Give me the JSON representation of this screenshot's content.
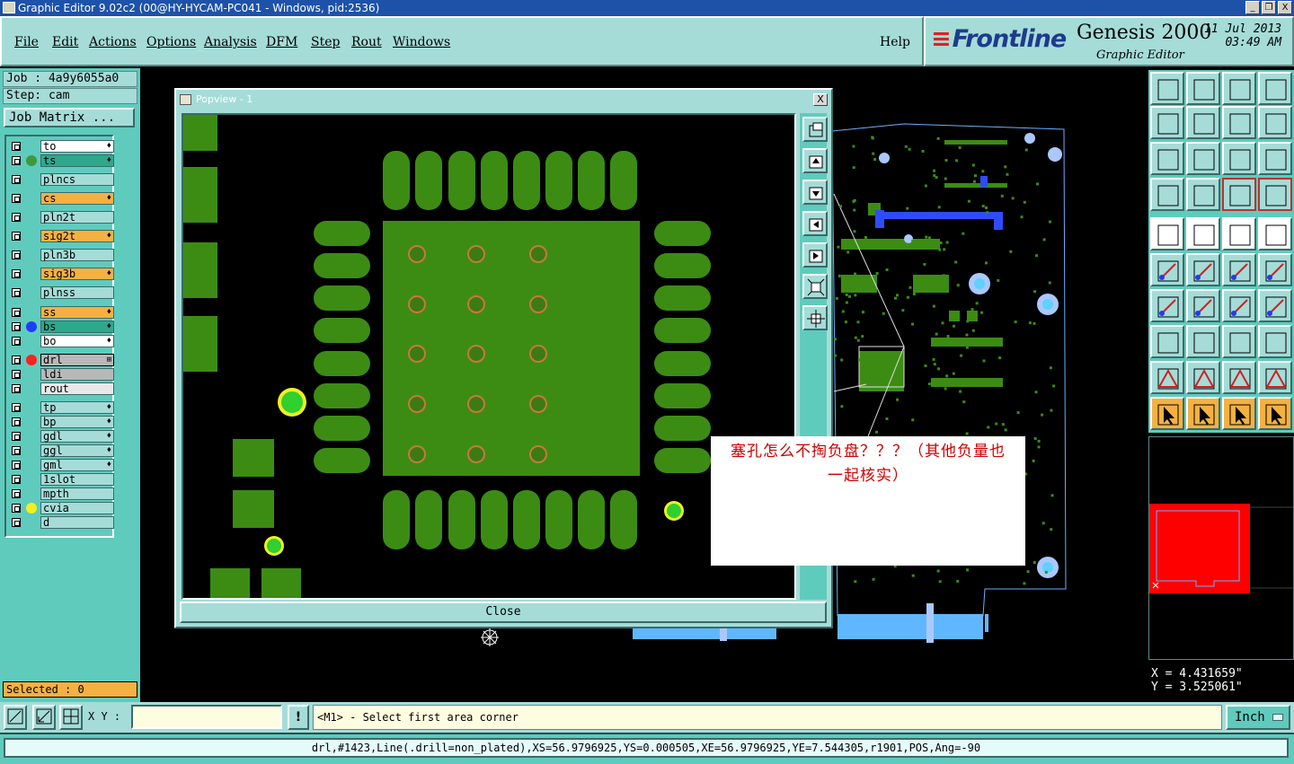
{
  "window": {
    "title": "Graphic Editor 9.02c2 (00@HY-HYCAM-PC041 - Windows, pid:2536)",
    "min": "_",
    "restore": "❐",
    "close": "X"
  },
  "menu": {
    "items": [
      "File",
      "Edit",
      "Actions",
      "Options",
      "Analysis",
      "DFM",
      "Step",
      "Rout",
      "Windows"
    ],
    "help": "Help"
  },
  "brand": {
    "logo": "Frontline",
    "product": "Genesis 2000",
    "subtitle": "Graphic Editor",
    "date": "11 Jul 2013",
    "time": "03:49 AM"
  },
  "job": {
    "job_label": "Job : 4a9y6055a0",
    "step_label": "Step: cam",
    "matrix_button": "Job Matrix ..."
  },
  "layers": [
    {
      "name": "to",
      "color": "#ffffff",
      "dot": "",
      "sym": "♦"
    },
    {
      "name": "ts",
      "color": "#2ea88c",
      "dot": "#3c9a3c",
      "sym": "♦"
    },
    {
      "name": "plncs",
      "color": "#a5dcd8",
      "dot": "",
      "sym": ""
    },
    {
      "name": "cs",
      "color": "#f4b142",
      "dot": "",
      "sym": "♦"
    },
    {
      "name": "pln2t",
      "color": "#a5dcd8",
      "dot": "",
      "sym": ""
    },
    {
      "name": "sig2t",
      "color": "#f4b142",
      "dot": "",
      "sym": "♦"
    },
    {
      "name": "pln3b",
      "color": "#a5dcd8",
      "dot": "",
      "sym": ""
    },
    {
      "name": "sig3b",
      "color": "#f4b142",
      "dot": "",
      "sym": "♦"
    },
    {
      "name": "plnss",
      "color": "#a5dcd8",
      "dot": "",
      "sym": ""
    },
    {
      "name": "ss",
      "color": "#f4b142",
      "dot": "",
      "sym": "♦"
    },
    {
      "name": "bs",
      "color": "#2ea88c",
      "dot": "#1e3cff",
      "sym": "♦"
    },
    {
      "name": "bo",
      "color": "#ffffff",
      "dot": "",
      "sym": "♦"
    },
    {
      "name": "drl",
      "color": "#b8b8b8",
      "dot": "#ff2020",
      "sym": "⊞"
    },
    {
      "name": "ldi",
      "color": "#b8b8b8",
      "dot": "",
      "sym": ""
    },
    {
      "name": "rout",
      "color": "#e8e8e8",
      "dot": "",
      "sym": ""
    },
    {
      "name": "tp",
      "color": "#a5dcd8",
      "dot": "",
      "sym": "♦"
    },
    {
      "name": "bp",
      "color": "#a5dcd8",
      "dot": "",
      "sym": "♦"
    },
    {
      "name": "gdl",
      "color": "#a5dcd8",
      "dot": "",
      "sym": "♦"
    },
    {
      "name": "ggl",
      "color": "#a5dcd8",
      "dot": "",
      "sym": "♦"
    },
    {
      "name": "gml",
      "color": "#a5dcd8",
      "dot": "",
      "sym": "♦"
    },
    {
      "name": "1slot",
      "color": "#a5dcd8",
      "dot": "",
      "sym": ""
    },
    {
      "name": "mpth",
      "color": "#a5dcd8",
      "dot": "",
      "sym": ""
    },
    {
      "name": "cvia",
      "color": "#a5dcd8",
      "dot": "#f0f020",
      "sym": ""
    },
    {
      "name": "d",
      "color": "#a5dcd8",
      "dot": "",
      "sym": ""
    }
  ],
  "selected": "Selected : 0",
  "popview": {
    "title": "Popview - 1",
    "close_x": "X",
    "close_button": "Close"
  },
  "annotation": {
    "line1": "塞孔怎么不掏负盘？？？（其他负量也",
    "line2": "一起核实）"
  },
  "coords": {
    "x": "X = 4.431659\"",
    "y": "Y = 3.525061\""
  },
  "bottom": {
    "xy_label": "X Y :",
    "xy_value": "",
    "excl": "!",
    "prompt": "<M1> - Select first area corner",
    "units": "Inch"
  },
  "status": "drl,#1423,Line(.drill=non_plated),XS=56.9796925,YS=0.000505,XE=56.9796925,YE=7.544305,r1901,POS,Ang=-90",
  "colors": {
    "panel": "#5fcbbd",
    "light": "#a5dcd8",
    "copper": "#3c8c14",
    "highlight": "#f4b142",
    "title_blue": "#1d52a8"
  }
}
